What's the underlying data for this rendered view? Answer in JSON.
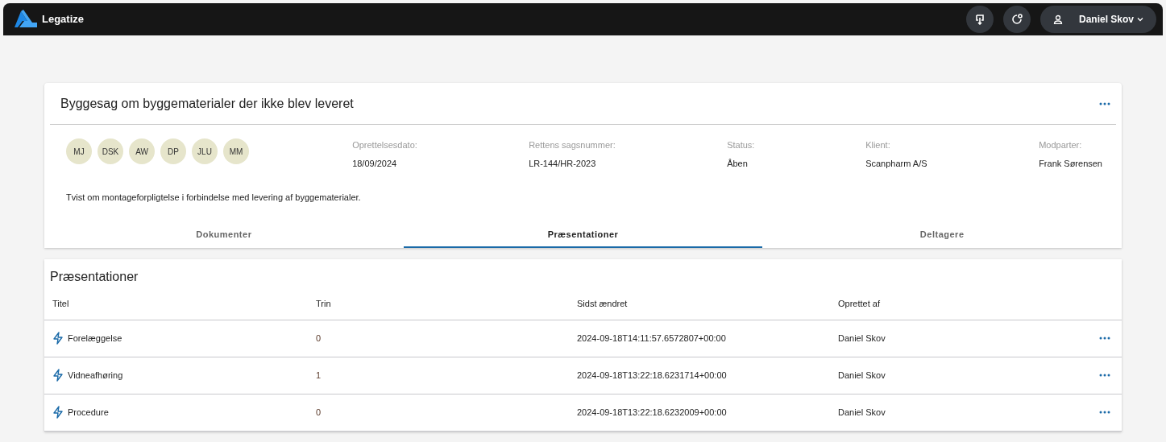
{
  "app": {
    "name": "Legatize"
  },
  "user": {
    "name": "Daniel Skov"
  },
  "case": {
    "title": "Byggesag om byggematerialer der ikke blev leveret",
    "participants": [
      "MJ",
      "DSK",
      "AW",
      "DP",
      "JLU",
      "MM"
    ],
    "fields": [
      {
        "label": "Oprettelsesdato:",
        "value": "18/09/2024"
      },
      {
        "label": "Rettens sagsnummer:",
        "value": "LR-144/HR-2023"
      },
      {
        "label": "Status:",
        "value": "Åben"
      },
      {
        "label": "Klient:",
        "value": "Scanpharm A/S"
      },
      {
        "label": "Modparter:",
        "value": "Frank Sørensen"
      }
    ],
    "description": "Tvist om montageforpligtelse i forbindelse med levering af byggematerialer."
  },
  "tabs": [
    {
      "label": "Dokumenter",
      "selected": false
    },
    {
      "label": "Præsentationer",
      "selected": true
    },
    {
      "label": "Deltagere",
      "selected": false
    }
  ],
  "table": {
    "title": "Præsentationer",
    "columns": [
      "Titel",
      "Trin",
      "Sidst ændret",
      "Oprettet af"
    ],
    "rows": [
      {
        "title": "Forelæggelse",
        "step": "0",
        "modified": "2024-09-18T14:11:57.6572807+00:00",
        "author": "Daniel Skov"
      },
      {
        "title": "Vidneafhøring",
        "step": "1",
        "modified": "2024-09-18T13:22:18.6231714+00:00",
        "author": "Daniel Skov"
      },
      {
        "title": "Procedure",
        "step": "0",
        "modified": "2024-09-18T13:22:18.6232009+00:00",
        "author": "Daniel Skov"
      }
    ]
  }
}
